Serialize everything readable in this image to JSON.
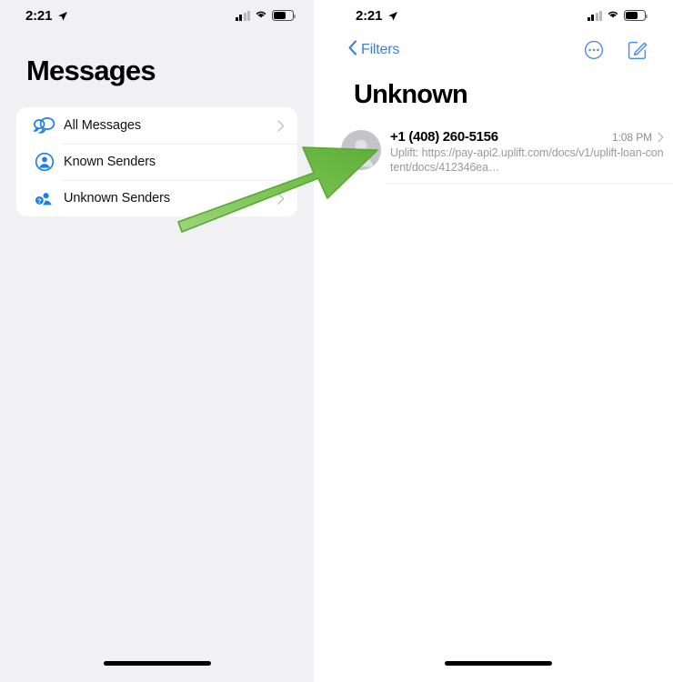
{
  "left_screen": {
    "status_bar": {
      "time": "2:21",
      "location_icon": "location-arrow-icon",
      "signal_icon": "cellular-signal-icon",
      "wifi_icon": "wifi-icon",
      "battery_icon": "battery-icon"
    },
    "title": "Messages",
    "filters": [
      {
        "label": "All Messages",
        "icon": "chat-bubbles-icon",
        "chevron": "›"
      },
      {
        "label": "Known Senders",
        "icon": "person-circle-icon",
        "chevron": ""
      },
      {
        "label": "Unknown Senders",
        "icon": "person-question-icon",
        "chevron": "›"
      }
    ]
  },
  "right_screen": {
    "status_bar": {
      "time": "2:21",
      "location_icon": "location-arrow-icon",
      "signal_icon": "cellular-signal-icon",
      "wifi_icon": "wifi-icon",
      "battery_icon": "battery-icon"
    },
    "nav": {
      "back_label": "Filters",
      "back_icon": "chevron-left-icon",
      "more_icon": "more-circle-icon",
      "compose_icon": "compose-icon"
    },
    "title": "Unknown",
    "conversations": [
      {
        "name": "+1 (408) 260-5156",
        "time": "1:08 PM",
        "preview": "Uplift: https://pay-api2.uplift.com/docs/v1/uplift-loan-content/docs/412346ea…",
        "avatar_icon": "person-avatar-icon",
        "chevron": "›"
      }
    ]
  },
  "annotation": {
    "arrow_icon": "green-arrow-icon",
    "color": "#63b63f"
  },
  "colors": {
    "accent_blue": "#007aff",
    "nav_blue": "#3b7fe0",
    "left_bg": "#f1f1f3",
    "card_bg": "#ffffff",
    "secondary_text": "#8e8e93",
    "arrow_green": "#63b63f"
  }
}
